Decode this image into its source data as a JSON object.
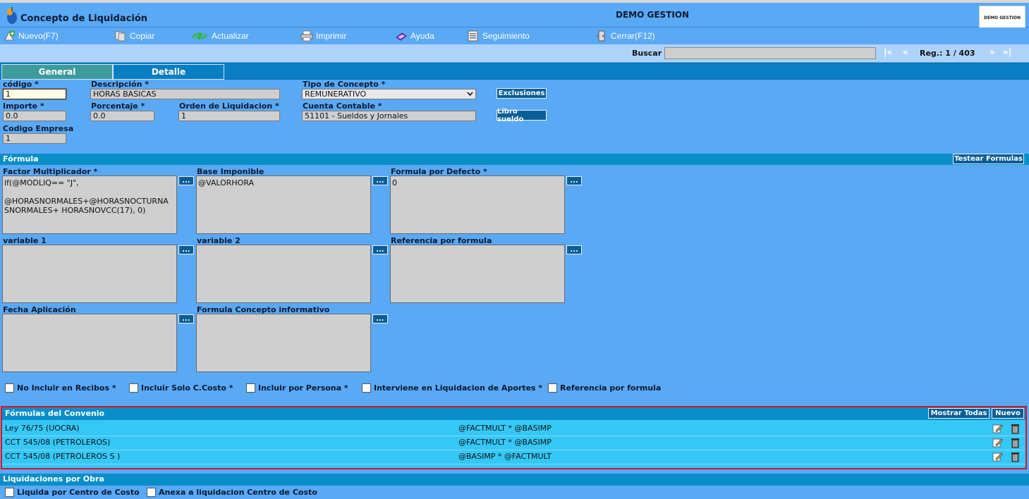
{
  "window": {
    "title": "Concepto de Liquidación",
    "company": "DEMO GESTION",
    "brand": "DEMO GESTION"
  },
  "toolbar": [
    {
      "id": "nuevo",
      "label": "Nuevo(F7)",
      "icon": "new-plus-icon"
    },
    {
      "id": "copiar",
      "label": "Copiar",
      "icon": "copy-icon"
    },
    {
      "id": "actualizar",
      "label": "Actualizar",
      "icon": "refresh-icon"
    },
    {
      "id": "imprimir",
      "label": "Imprimir",
      "icon": "printer-icon"
    },
    {
      "id": "ayuda",
      "label": "Ayuda",
      "icon": "help-book-icon"
    },
    {
      "id": "seguimiento",
      "label": "Seguimiento",
      "icon": "tracking-list-icon"
    },
    {
      "id": "cerrar",
      "label": "Cerrar(F12)",
      "icon": "close-door-icon"
    }
  ],
  "search": {
    "label": "Buscar",
    "value": "",
    "nav_first": "|«",
    "nav_prev": "«",
    "nav_next": "»",
    "nav_last": "»|",
    "reg": "Reg.: 1 / 403"
  },
  "tabs": [
    {
      "label": "General",
      "active": true
    },
    {
      "label": "Detalle",
      "active": false
    }
  ],
  "general": {
    "codigo": {
      "label": "código *",
      "value": "1"
    },
    "descripcion": {
      "label": "Descripción *",
      "value": "HORAS BASICAS"
    },
    "tipo": {
      "label": "Tipo de Concepto *",
      "value": "REMUNERATIVO"
    },
    "importe": {
      "label": "Importe *",
      "value": "0.0"
    },
    "porcentaje": {
      "label": "Porcentaje *",
      "value": "0.0"
    },
    "orden": {
      "label": "Orden de Liquidacion *",
      "value": "1"
    },
    "cuenta": {
      "label": "Cuenta Contable *",
      "value": "51101 - Sueldos y Jornales"
    },
    "empresa": {
      "label": "Codigo Empresa",
      "value": "1"
    },
    "btn_exclusiones": "Exclusiones",
    "btn_libro": "Libro sueldo"
  },
  "formula": {
    "section": "Fórmula",
    "btn_testear": "Testear Formulas",
    "factor": {
      "label": "Factor Multiplicador *",
      "value": "if(@MODLIQ== \"J\",\n\n@HORASNORMALES+@HORASNOCTURNA\nSNORMALES+ HORASNOVCC(17), 0)"
    },
    "base": {
      "label": "Base Imponible",
      "value": "@VALORHORA"
    },
    "defecto": {
      "label": "Formula por Defecto *",
      "value": "0"
    },
    "var1": {
      "label": "variable 1",
      "value": ""
    },
    "var2": {
      "label": "variable 2",
      "value": ""
    },
    "referencia": {
      "label": "Referencia por formula",
      "value": ""
    },
    "fecha": {
      "label": "Fecha Aplicación",
      "value": ""
    },
    "informativo": {
      "label": "Formula Concepto informativo",
      "value": ""
    },
    "dots": "..."
  },
  "checks": [
    {
      "label": "No Incluir en Recibos *",
      "checked": false
    },
    {
      "label": "Incluir Solo C.Costo *",
      "checked": false
    },
    {
      "label": "Incluir por Persona *",
      "checked": false
    },
    {
      "label": "Interviene en Liquidacion de Aportes *",
      "checked": false
    },
    {
      "label": "Referencia por formula",
      "checked": false
    }
  ],
  "convenio": {
    "section": "Fórmulas del Convenio",
    "btn_mostrar": "Mostrar Todas",
    "btn_nuevo": "Nuevo",
    "rows": [
      {
        "name": "Ley 76/75 (UOCRA)",
        "formula": "@FACTMULT * @BASIMP"
      },
      {
        "name": "CCT 545/08 (PETROLEROS)",
        "formula": "@FACTMULT * @BASIMP"
      },
      {
        "name": "CCT 545/08 (PETROLEROS S )",
        "formula": "@BASIMP * @FACTMULT"
      }
    ]
  },
  "liquidaciones": {
    "section": "Liquidaciones por Obra",
    "checks": [
      {
        "label": "Liquida por Centro de Costo",
        "checked": false
      },
      {
        "label": "Anexa a liquidacion Centro de Costo",
        "checked": false
      }
    ]
  },
  "colors": {
    "background": "#5aa9f5",
    "section": "#0a8ec7",
    "convenio_border": "#e01020",
    "convenio_bg": "#35c8f7",
    "button": "#0a5e96"
  }
}
